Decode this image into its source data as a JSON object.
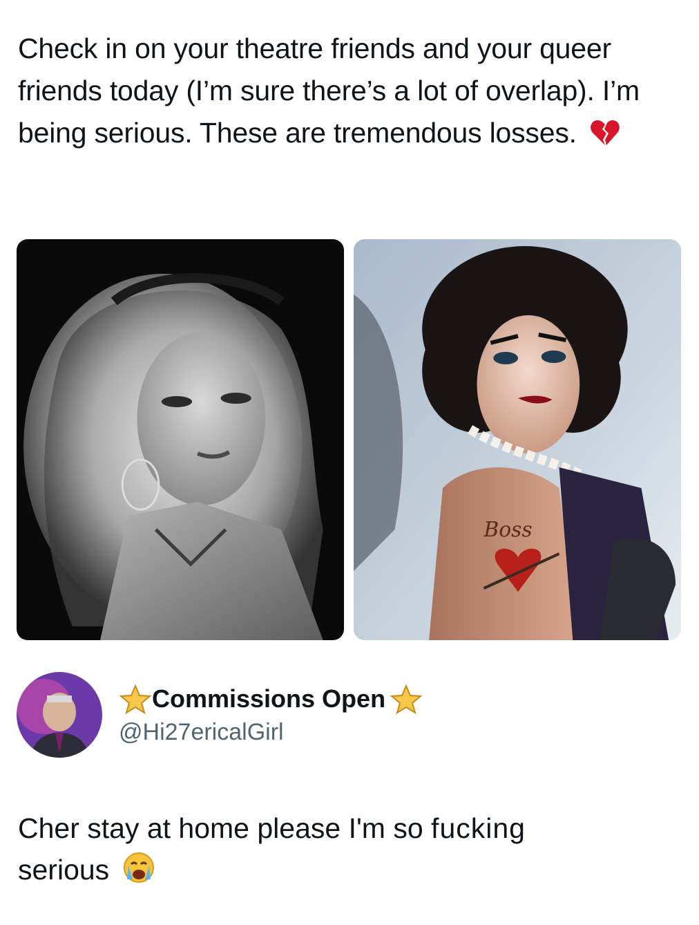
{
  "post": {
    "text": "Check in on your theatre friends and your queer friends today (I’m sure there’s a lot of overlap). I’m being serious. These are tremendous losses.",
    "emoji": "broken-heart-emoji"
  },
  "media": [
    {
      "kind": "photo",
      "icon": "grayscale-portrait"
    },
    {
      "kind": "photo",
      "icon": "color-portrait",
      "tattoo_text": "Boss"
    }
  ],
  "reply": {
    "display_name": "Commissions Open",
    "name_decoration": "star-emoji",
    "handle": "@Hi27ericalGirl",
    "text_part1": "Cher stay at home please I'm so ",
    "text_glitch": "fucking",
    "text_part2": "serious",
    "emoji": "loudly-crying-face-emoji"
  },
  "colors": {
    "text": "#0f1419",
    "secondary_text": "#536471",
    "background": "#ffffff"
  }
}
